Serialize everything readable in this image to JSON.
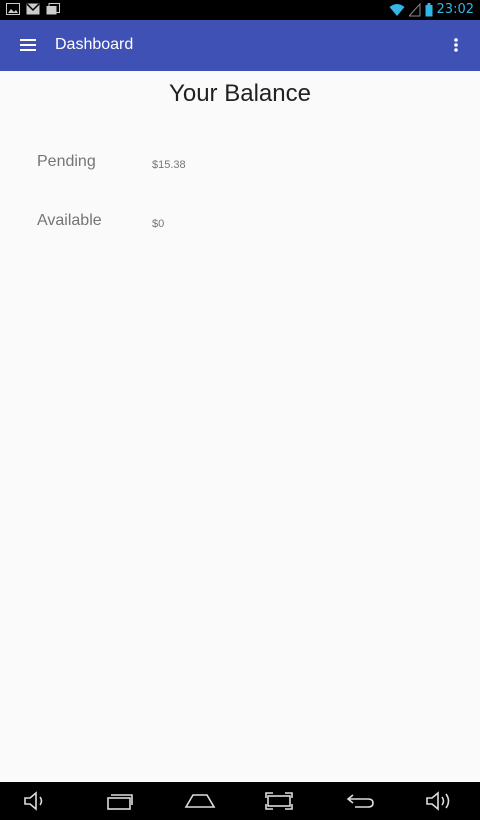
{
  "status_bar": {
    "time": "23:02",
    "left_icons": [
      "image-icon",
      "gmail-icon",
      "photo-stack-icon"
    ],
    "right_icons": [
      "wifi-icon",
      "signal-icon",
      "battery-icon"
    ],
    "accent_color": "#33b5e5"
  },
  "app_bar": {
    "title": "Dashboard",
    "menu_icon": "hamburger-menu-icon",
    "overflow_icon": "more-vertical-icon",
    "color": "#3f51b5"
  },
  "main": {
    "title": "Your Balance",
    "rows": [
      {
        "label": "Pending",
        "value": "$15.38"
      },
      {
        "label": "Available",
        "value": "$0"
      }
    ]
  },
  "nav_bar": {
    "buttons": [
      "volume-down-icon",
      "recent-apps-icon",
      "home-icon",
      "screenshot-icon",
      "back-icon",
      "volume-up-icon"
    ]
  }
}
